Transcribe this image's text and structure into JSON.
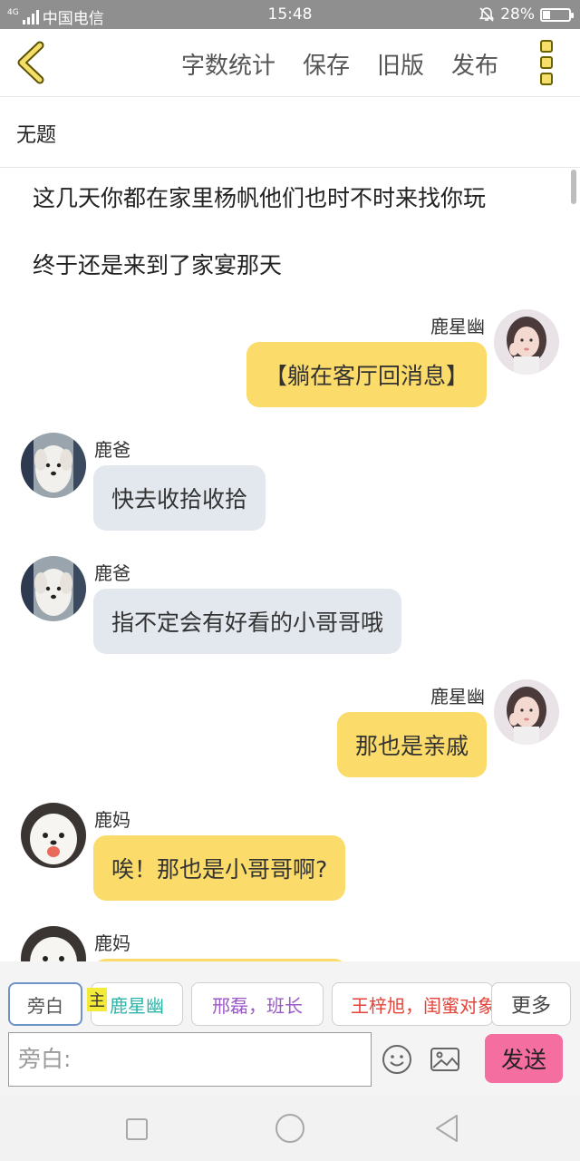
{
  "status": {
    "network_tag": "4G",
    "carrier": "中国电信",
    "time": "15:48",
    "battery": "28%",
    "battery_level": 0.28
  },
  "toolbar": {
    "back_icon": "chevron-left-icon",
    "word_count": "字数统计",
    "save": "保存",
    "old_version": "旧版",
    "publish": "发布",
    "more_icon": "vertical-dots-icon"
  },
  "title": "无题",
  "narration": [
    "这几天你都在家里杨帆他们也时不时来找你玩",
    "终于还是来到了家宴那天"
  ],
  "messages": [
    {
      "speaker": "鹿星幽",
      "text": "【躺在客厅回消息】",
      "side": "right",
      "color": "yellow"
    },
    {
      "speaker": "鹿爸",
      "text": "快去收拾收拾",
      "side": "left",
      "color": "grey"
    },
    {
      "speaker": "鹿爸",
      "text": "指不定会有好看的小哥哥哦",
      "side": "left",
      "color": "grey"
    },
    {
      "speaker": "鹿星幽",
      "text": "那也是亲戚",
      "side": "right",
      "color": "yellow"
    },
    {
      "speaker": "鹿妈",
      "text": "唉！那也是小哥哥啊?",
      "side": "left",
      "color": "yellow"
    },
    {
      "speaker": "鹿妈",
      "text": "",
      "side": "left",
      "color": "yellow"
    }
  ],
  "roles": {
    "narrator": "旁白",
    "main_badge": "主",
    "role1": "鹿星幽",
    "role2": "邢磊，班长",
    "role3": "王梓旭，闺蜜对象",
    "more": "更多"
  },
  "input": {
    "placeholder": "旁白:",
    "emoji_icon": "smiley-icon",
    "image_icon": "image-icon",
    "send": "发送"
  },
  "nav": {
    "recent_icon": "square-icon",
    "home_icon": "circle-icon",
    "back_icon": "triangle-back-icon"
  },
  "colors": {
    "accent_yellow": "#fbdb6a",
    "bubble_grey": "#e3e8ef",
    "send_pink": "#f46ea0",
    "role1_teal": "#2bb5a8",
    "role2_purple": "#9b59c9",
    "role3_red": "#e2443a"
  }
}
